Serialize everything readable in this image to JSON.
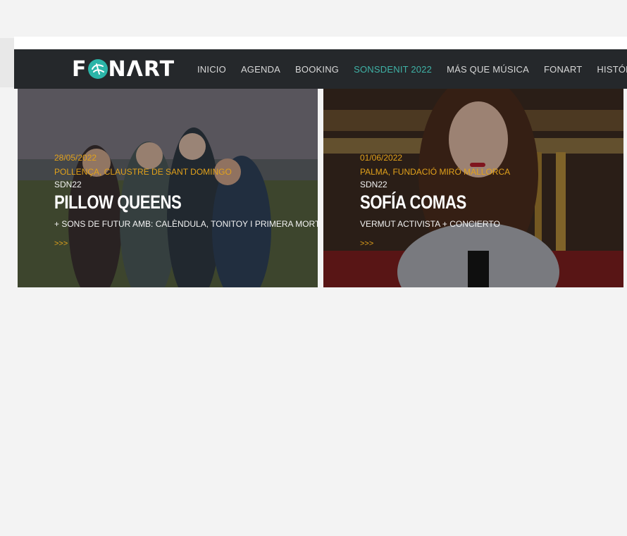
{
  "brand": {
    "logo_text_left": "F",
    "logo_text_right": "NɅRT",
    "accent_color": "#3fb2a6",
    "highlight_color": "#e2a21b"
  },
  "nav": {
    "items": [
      {
        "label": "INICIO",
        "active": false
      },
      {
        "label": "AGENDA",
        "active": false
      },
      {
        "label": "BOOKING",
        "active": false
      },
      {
        "label": "SONSDENIT 2022",
        "active": true
      },
      {
        "label": "MÁS QUE MÚSICA",
        "active": false
      },
      {
        "label": "FONART",
        "active": false
      },
      {
        "label": "HISTÓRIC",
        "active": false
      }
    ]
  },
  "events": [
    {
      "date": "28/05/2022",
      "venue": "POLLENÇA, CLAUSTRE DE SANT DOMINGO",
      "tag": "SDN22",
      "title": "PILLOW QUEENS",
      "subtitle": "+ SONS DE FUTUR AMB: CALÈNDULA, TONITOY I PRIMERA MORT",
      "more": ">>>"
    },
    {
      "date": "01/06/2022",
      "venue": "PALMA, FUNDACIÓ MIRÓ MALLORCA",
      "tag": "SDN22",
      "title": "SOFÍA COMAS",
      "subtitle": "VERMUT ACTIVISTA + CONCIERTO",
      "more": ">>>"
    }
  ]
}
